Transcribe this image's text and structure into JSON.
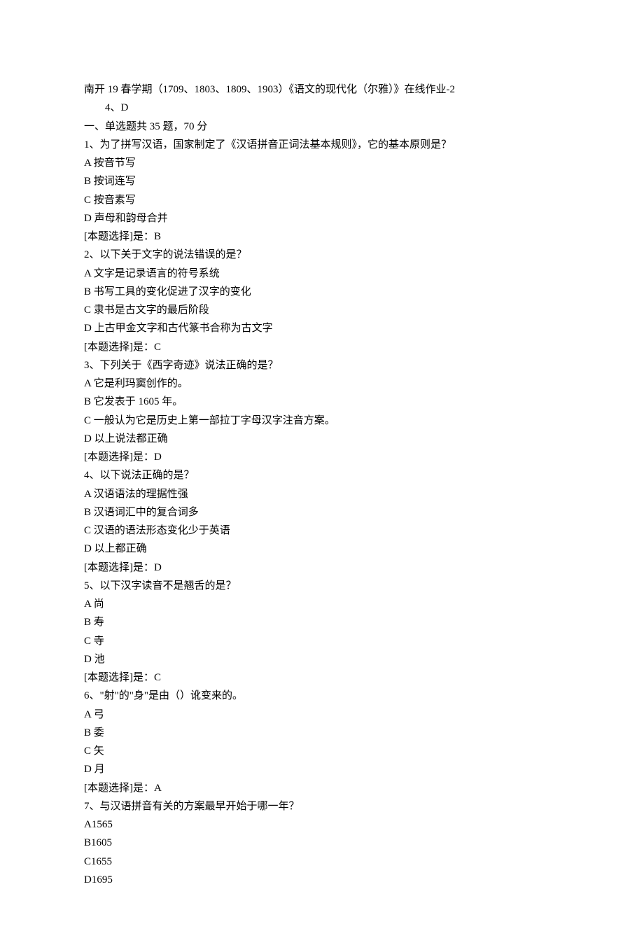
{
  "header": {
    "title": "南开 19 春学期（1709、1803、1809、1903）《语文的现代化（尔雅）》在线作业-2",
    "sub_line": "4、D"
  },
  "section": {
    "heading": "一、单选题共 35 题，70 分"
  },
  "questions": [
    {
      "num": "1",
      "text": "为了拼写汉语，国家制定了《汉语拼音正词法基本规则》，它的基本原则是？",
      "options": [
        {
          "label": "A",
          "text": "按音节写"
        },
        {
          "label": "B",
          "text": "按词连写"
        },
        {
          "label": "C",
          "text": "按音素写"
        },
        {
          "label": "D",
          "text": "声母和韵母合并"
        }
      ],
      "answer_prefix": "[本题选择]是：",
      "answer": "B"
    },
    {
      "num": "2",
      "text": "以下关于文字的说法错误的是？",
      "options": [
        {
          "label": "A",
          "text": "文字是记录语言的符号系统"
        },
        {
          "label": "B",
          "text": "书写工具的变化促进了汉字的变化"
        },
        {
          "label": "C",
          "text": "隶书是古文字的最后阶段"
        },
        {
          "label": "D",
          "text": "上古甲金文字和古代篆书合称为古文字"
        }
      ],
      "answer_prefix": "[本题选择]是：",
      "answer": "C"
    },
    {
      "num": "3",
      "text": "下列关于《西字奇迹》说法正确的是？",
      "options": [
        {
          "label": "A",
          "text": "它是利玛窦创作的。"
        },
        {
          "label": "B",
          "text": "它发表于 1605 年。"
        },
        {
          "label": "C",
          "text": "一般认为它是历史上第一部拉丁字母汉字注音方案。"
        },
        {
          "label": "D",
          "text": "以上说法都正确"
        }
      ],
      "answer_prefix": "[本题选择]是：",
      "answer": "D"
    },
    {
      "num": "4",
      "text": "以下说法正确的是？",
      "options": [
        {
          "label": "A",
          "text": "汉语语法的理据性强"
        },
        {
          "label": "B",
          "text": "汉语词汇中的复合词多"
        },
        {
          "label": "C",
          "text": "汉语的语法形态变化少于英语"
        },
        {
          "label": "D",
          "text": "以上都正确"
        }
      ],
      "answer_prefix": "[本题选择]是：",
      "answer": "D"
    },
    {
      "num": "5",
      "text": "以下汉字读音不是翘舌的是？",
      "options": [
        {
          "label": "A",
          "text": "尚"
        },
        {
          "label": "B",
          "text": "寿"
        },
        {
          "label": "C",
          "text": "寺"
        },
        {
          "label": "D",
          "text": "池"
        }
      ],
      "answer_prefix": "[本题选择]是：",
      "answer": "C"
    },
    {
      "num": "6",
      "text": "\"射\"的\"身\"是由（）讹变来的。",
      "options": [
        {
          "label": "A",
          "text": "弓"
        },
        {
          "label": "B",
          "text": "委"
        },
        {
          "label": "C",
          "text": "矢"
        },
        {
          "label": "D",
          "text": "月"
        }
      ],
      "answer_prefix": "[本题选择]是：",
      "answer": "A"
    },
    {
      "num": "7",
      "text": "与汉语拼音有关的方案最早开始于哪一年？",
      "options": [
        {
          "label": "A",
          "text": "1565"
        },
        {
          "label": "B",
          "text": "1605"
        },
        {
          "label": "C",
          "text": "1655"
        },
        {
          "label": "D",
          "text": "1695"
        }
      ],
      "answer_prefix": "",
      "answer": ""
    }
  ]
}
